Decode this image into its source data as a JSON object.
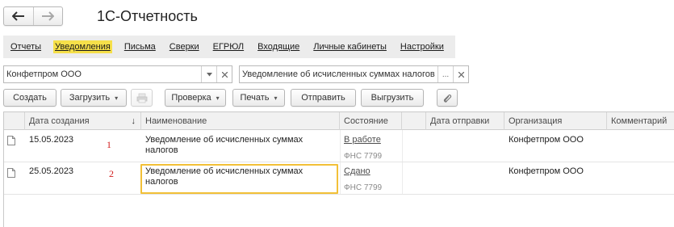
{
  "app": {
    "title": "1С-Отчетность"
  },
  "nav": {
    "back_icon": "arrow-left-icon",
    "forward_icon": "arrow-right-icon"
  },
  "menu": [
    {
      "label": "Отчеты",
      "active": false
    },
    {
      "label": "Уведомления",
      "active": true
    },
    {
      "label": "Письма",
      "active": false
    },
    {
      "label": "Сверки",
      "active": false
    },
    {
      "label": "ЕГРЮЛ",
      "active": false
    },
    {
      "label": "Входящие",
      "active": false
    },
    {
      "label": "Личные кабинеты",
      "active": false
    },
    {
      "label": "Настройки",
      "active": false
    }
  ],
  "filters": {
    "organization": {
      "value": "Конфетпром ООО",
      "dropdown_icon": "triangle-down-icon",
      "clear_icon": "close-icon"
    },
    "document_type": {
      "value": "Уведомление об исчисленных суммах налогов",
      "select_label": "...",
      "clear_icon": "close-icon"
    }
  },
  "toolbar": {
    "create": "Создать",
    "load": "Загрузить",
    "print_icon": "printer-icon",
    "check": "Проверка",
    "print": "Печать",
    "send": "Отправить",
    "export": "Выгрузить",
    "attach_icon": "paperclip-icon",
    "dropdown_glyph": "▾"
  },
  "table": {
    "columns": {
      "created": "Дата создания",
      "name": "Наименование",
      "status": "Состояние",
      "sent": "Дата отправки",
      "org": "Организация",
      "comment": "Комментарий"
    },
    "sort_icon": "sort-arrow-down-icon",
    "sort_glyph": "↓",
    "rows": [
      {
        "marker": "1",
        "date": "15.05.2023",
        "name": "Уведомление об исчисленных суммах налогов",
        "status": "В работе",
        "status_sub": "ФНС 7799",
        "sent": "",
        "org": "Конфетпром ООО",
        "comment": "",
        "highlighted": false
      },
      {
        "marker": "2",
        "date": "25.05.2023",
        "name": "Уведомление об исчисленных суммах налогов",
        "status": "Сдано",
        "status_sub": "ФНС 7799",
        "sent": "",
        "org": "Конфетпром ООО",
        "comment": "",
        "highlighted": true
      }
    ]
  },
  "colors": {
    "active_menu": "#f6e04a",
    "highlight_border": "#f2c037",
    "marker": "#d22020"
  }
}
